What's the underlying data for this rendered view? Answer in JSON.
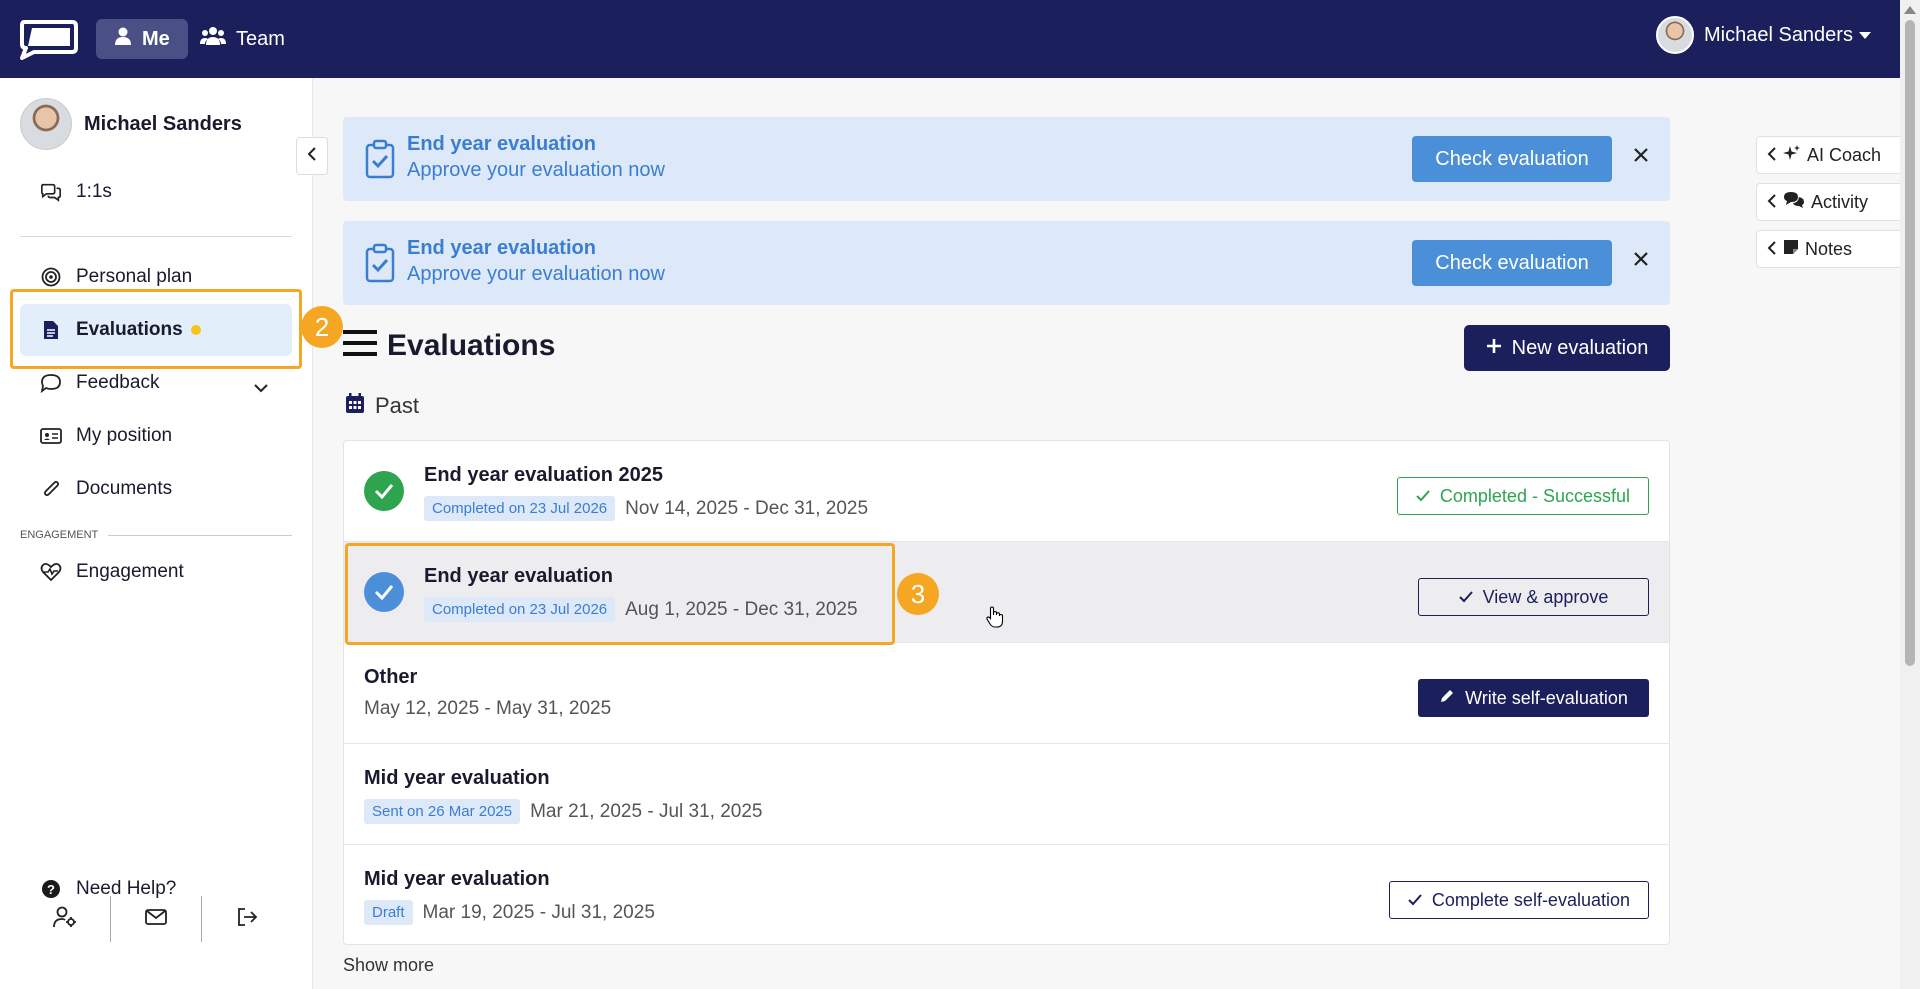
{
  "topbar": {
    "nav_me": "Me",
    "nav_team": "Team",
    "user_name": "Michael Sanders"
  },
  "sidebar": {
    "profile_name": "Michael Sanders",
    "items": [
      {
        "label": "1:1s",
        "icon": "chat-icon"
      },
      {
        "label": "Personal plan",
        "icon": "target-icon"
      },
      {
        "label": "Evaluations",
        "icon": "document-icon",
        "active": true
      },
      {
        "label": "Feedback",
        "icon": "comment-icon"
      },
      {
        "label": "My position",
        "icon": "id-card-icon"
      },
      {
        "label": "Documents",
        "icon": "paperclip-icon"
      },
      {
        "label": "Engagement",
        "icon": "heart-pulse-icon"
      }
    ],
    "section_engagement": "ENGAGEMENT",
    "need_help": "Need Help?"
  },
  "annotations": {
    "sidebar_marker": "2",
    "row_marker": "3"
  },
  "banners": [
    {
      "title": "End year evaluation",
      "subtitle": "Approve your evaluation now",
      "button": "Check evaluation"
    },
    {
      "title": "End year evaluation",
      "subtitle": "Approve your evaluation now",
      "button": "Check evaluation"
    }
  ],
  "main": {
    "title": "Evaluations",
    "new_button": "New evaluation",
    "section": "Past",
    "show_more": "Show more"
  },
  "evaluations": [
    {
      "title": "End year evaluation 2025",
      "badge": "Completed on 23 Jul 2026",
      "dates": "Nov 14, 2025 - Dec 31, 2025",
      "action": "Completed - Successful",
      "status_color": "#2ea44f"
    },
    {
      "title": "End year evaluation",
      "badge": "Completed on 23 Jul 2026",
      "dates": "Aug 1, 2025 - Dec 31, 2025",
      "action": "View & approve",
      "status_color": "#4b8fd9"
    },
    {
      "title": "Other",
      "badge": "",
      "dates": "May 12, 2025 - May 31, 2025",
      "action": "Write self-evaluation"
    },
    {
      "title": "Mid year evaluation",
      "badge": "Sent on 26 Mar 2025",
      "dates": "Mar 21, 2025 - Jul 31, 2025",
      "action": ""
    },
    {
      "title": "Mid year evaluation",
      "badge": "Draft",
      "dates": "Mar 19, 2025 - Jul 31, 2025",
      "action": "Complete self-evaluation"
    }
  ],
  "right_panel": {
    "ai_coach": "AI Coach",
    "activity": "Activity",
    "notes": "Notes"
  },
  "colors": {
    "brand": "#1b1f5c",
    "accent": "#4b8fd9",
    "highlight": "#f5a623",
    "success": "#2ea44f"
  }
}
